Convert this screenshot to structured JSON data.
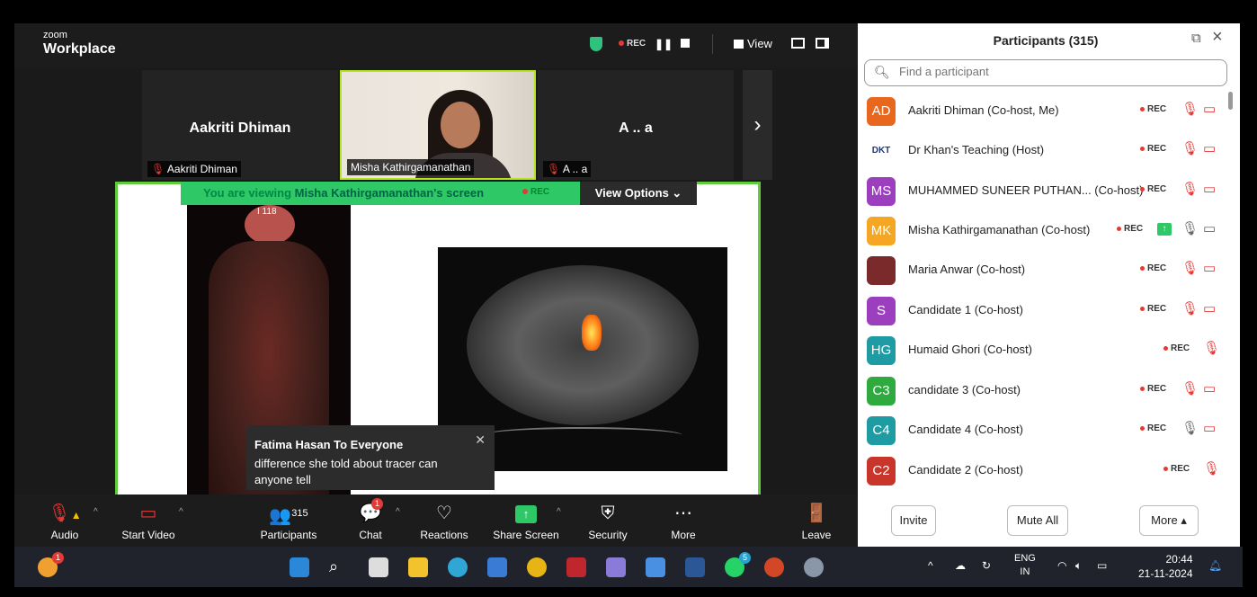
{
  "app": {
    "logo_small": "zoom",
    "logo_big": "Workplace"
  },
  "topbar": {
    "rec": "REC",
    "view": "View"
  },
  "tiles": [
    {
      "name": "Aakriti Dhiman",
      "label": "Aakriti Dhiman"
    },
    {
      "label": "Misha Kathirgamanathan"
    },
    {
      "name": "A .. a",
      "label": "A .. a"
    }
  ],
  "share_banner": {
    "prefix": "You are viewing",
    "owner": "Misha Kathirgamanathan's screen",
    "rec": "REC",
    "view_options": "View Options"
  },
  "slide": {
    "scan_label": "I 118"
  },
  "chat_toast": {
    "title": "Fatima Hasan To Everyone",
    "message": "difference she told about tracer can anyone tell"
  },
  "toolbar": {
    "audio": "Audio",
    "start_video": "Start Video",
    "participants": "Participants",
    "participants_count": "315",
    "chat": "Chat",
    "chat_badge": "1",
    "reactions": "Reactions",
    "share_screen": "Share Screen",
    "security": "Security",
    "more": "More",
    "leave": "Leave"
  },
  "panel": {
    "title": "Participants (315)",
    "search_placeholder": "Find a participant",
    "rec": "REC",
    "participants": [
      {
        "initials": "AD",
        "color": "#e8671f",
        "name": "Aakriti Dhiman (Co-host, Me)",
        "mic": "muted",
        "cam": "off"
      },
      {
        "initials": "DKT",
        "color": "#ffffff",
        "name": "Dr Khan's Teaching (Host)",
        "mic": "muted",
        "cam": "off"
      },
      {
        "initials": "MS",
        "color": "#9c3fbf",
        "name": "MUHAMMED SUNEER PUTHAN... (Co-host)",
        "mic": "muted",
        "cam": "off"
      },
      {
        "initials": "MK",
        "color": "#f5a623",
        "name": "Misha Kathirgamanathan (Co-host)",
        "mic": "on",
        "cam": "on",
        "sharing": true
      },
      {
        "initials": "",
        "color": "#7a2a2a",
        "name": "Maria Anwar (Co-host)",
        "mic": "muted",
        "cam": "off"
      },
      {
        "initials": "S",
        "color": "#9c3fbf",
        "name": "Candidate 1 (Co-host)",
        "mic": "muted",
        "cam": "off"
      },
      {
        "initials": "HG",
        "color": "#1f9ca3",
        "name": "Humaid Ghori (Co-host)",
        "mic": "muted",
        "cam": "none"
      },
      {
        "initials": "C3",
        "color": "#2eaa3f",
        "name": "candidate 3 (Co-host)",
        "mic": "muted",
        "cam": "off"
      },
      {
        "initials": "C4",
        "color": "#1f9ca3",
        "name": "Candidate 4 (Co-host)",
        "mic": "on",
        "cam": "off"
      },
      {
        "initials": "C2",
        "color": "#c9352b",
        "name": "Candidate 2 (Co-host)",
        "mic": "muted",
        "cam": "none"
      }
    ],
    "invite": "Invite",
    "mute_all": "Mute All",
    "more": "More"
  },
  "taskbar": {
    "lang_top": "ENG",
    "lang_bottom": "IN",
    "time": "20:44",
    "date": "21-11-2024",
    "weather_badge": "1",
    "whatsapp_badge": "5"
  }
}
